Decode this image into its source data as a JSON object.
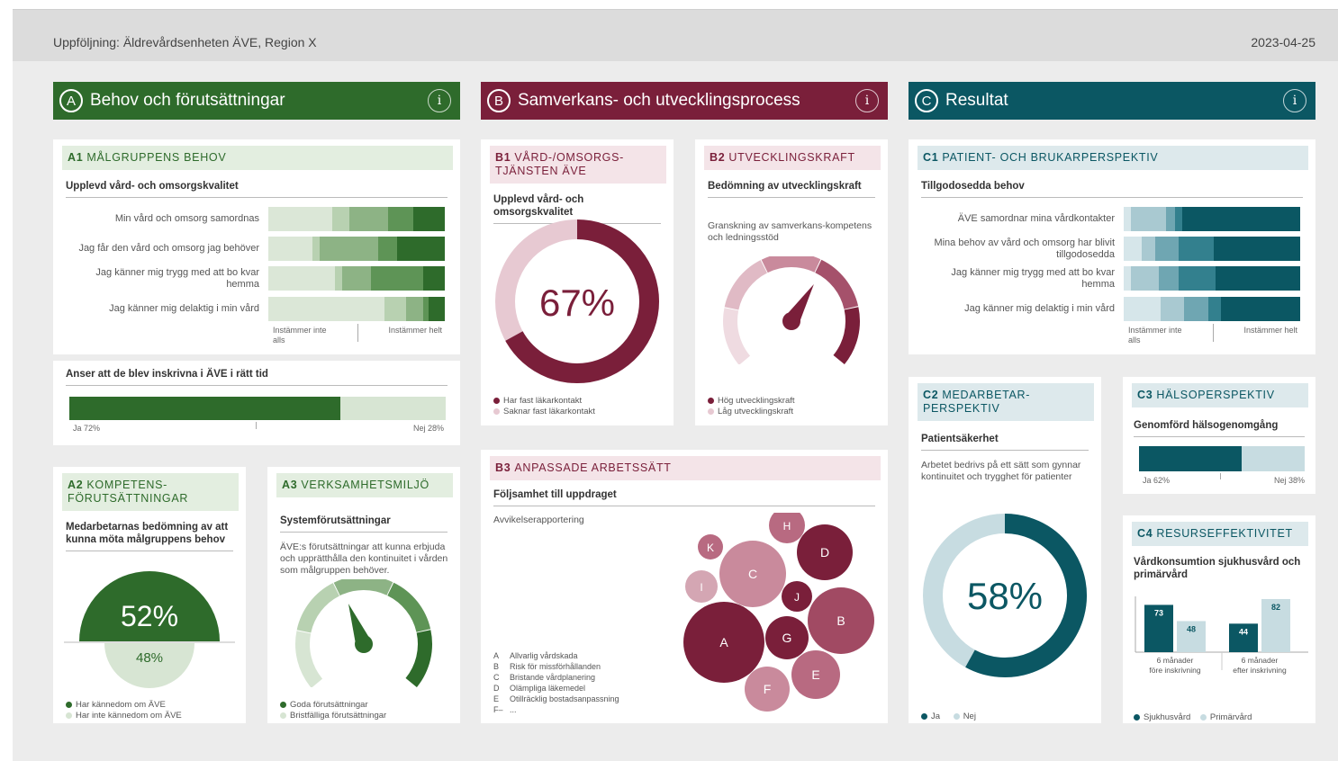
{
  "header": {
    "title": "Uppföljning: Äldrevårdsenheten ÄVE, Region X",
    "date": "2023-04-25"
  },
  "colors": {
    "green": "#2e6b2b",
    "maroon": "#7a1f3a",
    "teal": "#0b5763"
  },
  "sections": {
    "a": {
      "letter": "A",
      "title": "Behov och förutsättningar"
    },
    "b": {
      "letter": "B",
      "title": "Samverkans- och utvecklingsprocess"
    },
    "c": {
      "letter": "C",
      "title": "Resultat"
    }
  },
  "info_icon": "i",
  "a1": {
    "code": "A1",
    "title": "MÅLGRUPPENS BEHOV",
    "subtitle": "Upplevd vård- och omsorgskvalitet",
    "rows": [
      {
        "label": "Min vård och omsorg samordnas",
        "segments": [
          0.36,
          0.1,
          0.22,
          0.14,
          0.18
        ]
      },
      {
        "label": "Jag får den vård och omsorg jag behöver",
        "segments": [
          0.25,
          0.04,
          0.33,
          0.11,
          0.27
        ]
      },
      {
        "label": "Jag känner mig trygg med att bo kvar hemma",
        "segments": [
          0.38,
          0.04,
          0.16,
          0.3,
          0.12
        ]
      },
      {
        "label": "Jag känner mig delaktig i min vård",
        "segments": [
          0.66,
          0.12,
          0.1,
          0.03,
          0.09
        ]
      }
    ],
    "axis_left": "Instämmer inte alls",
    "axis_right": "Instämmer helt",
    "bar_title": "Anser att de blev inskrivna i ÄVE i rätt tid",
    "yes_pct": 72,
    "yes_label": "Ja 72%",
    "no_label": "Nej 28%"
  },
  "a2": {
    "code": "A2",
    "title": "KOMPETENS-FÖRUTSÄTTNINGAR",
    "subtitle": "Medarbetarnas bedömning av att kunna möta målgruppens behov",
    "value_top": "52%",
    "value_bottom": "48%",
    "legend": [
      "Har kännedom om ÄVE",
      "Har inte kännedom om ÄVE"
    ]
  },
  "a3": {
    "code": "A3",
    "title": "VERKSAMHETSMILJÖ",
    "subtitle": "Systemförutsättningar",
    "description": "ÄVE:s förutsättningar att kunna erbjuda och upprätthålla den kontinuitet i vården som målgruppen behöver.",
    "gauge_value": 0.42,
    "legend": [
      "Goda förutsättningar",
      "Bristfälliga förutsättningar"
    ]
  },
  "b1": {
    "code": "B1",
    "title": "VÅRD-/OMSORGS-TJÄNSTEN ÄVE",
    "subtitle": "Upplevd vård- och omsorgskvalitet",
    "value": 67,
    "label": "67%",
    "legend": [
      "Har fast läkarkontakt",
      "Saknar fast läkarkontakt"
    ]
  },
  "b2": {
    "code": "B2",
    "title": "UTVECKLINGSKRAFT",
    "subtitle": "Bedömning av utvecklingskraft",
    "description": "Granskning av samverkans-kompetens och ledningsstöd",
    "gauge_value": 0.62,
    "legend": [
      "Hög utvecklingskraft",
      "Låg utvecklingskraft"
    ]
  },
  "b3": {
    "code": "B3",
    "title": "ANPASSADE ARBETSSÄTT",
    "subtitle": "Följsamhet till uppdraget",
    "description": "Avvikelserapportering",
    "categories": [
      {
        "key": "A",
        "label": "Allvarlig vårdskada"
      },
      {
        "key": "B",
        "label": "Risk för missförhållanden"
      },
      {
        "key": "C",
        "label": "Bristande vårdplanering"
      },
      {
        "key": "D",
        "label": "Olämpliga läkemedel"
      },
      {
        "key": "E",
        "label": "Otillräcklig bostadsanpassning"
      },
      {
        "key": "F",
        "label": "..."
      }
    ],
    "bubbles": [
      "A",
      "B",
      "C",
      "D",
      "E",
      "F",
      "G",
      "H",
      "I",
      "J",
      "K"
    ]
  },
  "c1": {
    "code": "C1",
    "title": "PATIENT- OCH BRUKARPERSPEKTIV",
    "subtitle": "Tillgodosedda behov",
    "rows": [
      {
        "label": "ÄVE samordnar mina vårdkontakter",
        "segments": [
          0.04,
          0.2,
          0.05,
          0.04,
          0.67
        ]
      },
      {
        "label": "Mina behov av vård och omsorg har blivit tillgodosedda",
        "segments": [
          0.1,
          0.08,
          0.13,
          0.2,
          0.49
        ]
      },
      {
        "label": "Jag känner mig trygg med att bo kvar hemma",
        "segments": [
          0.04,
          0.16,
          0.11,
          0.21,
          0.48
        ]
      },
      {
        "label": "Jag känner mig delaktig i min vård",
        "segments": [
          0.21,
          0.13,
          0.14,
          0.07,
          0.45
        ]
      }
    ],
    "axis_left": "Instämmer inte alls",
    "axis_right": "Instämmer helt"
  },
  "c2": {
    "code": "C2",
    "title": "MEDARBETAR-PERSPEKTIV",
    "subtitle": "Patientsäkerhet",
    "description": "Arbetet bedrivs på ett sätt som gynnar kontinuitet och trygghet för patienter",
    "value": 58,
    "label": "58%",
    "legend": [
      "Ja",
      "Nej"
    ]
  },
  "c3": {
    "code": "C3",
    "title": "HÄLSOPERSPEKTIV",
    "subtitle": "Genomförd hälsogenomgång",
    "yes_pct": 62,
    "yes_label": "Ja 62%",
    "no_label": "Nej 38%"
  },
  "c4": {
    "code": "C4",
    "title": "RESURSEFFEKTIVITET",
    "subtitle": "Vårdkonsumtion sjukhusvård och primärvård",
    "legend": [
      "Sjukhusvård",
      "Primärvård"
    ]
  },
  "chart_data": [
    {
      "type": "bar",
      "id": "c4",
      "categories": [
        "6 månader före inskrivning",
        "6 månader efter inskrivning"
      ],
      "series": [
        {
          "name": "Sjukhusvård",
          "values": [
            73,
            44
          ]
        },
        {
          "name": "Primärvård",
          "values": [
            48,
            82
          ]
        }
      ],
      "ylim": [
        0,
        100
      ]
    },
    {
      "type": "pie",
      "id": "b1",
      "values": [
        67,
        33
      ],
      "labels": [
        "Har fast läkarkontakt",
        "Saknar fast läkarkontakt"
      ]
    },
    {
      "type": "pie",
      "id": "c2",
      "values": [
        58,
        42
      ],
      "labels": [
        "Ja",
        "Nej"
      ]
    },
    {
      "type": "bar",
      "id": "a1-time",
      "categories": [
        "Ja",
        "Nej"
      ],
      "values": [
        72,
        28
      ]
    },
    {
      "type": "bar",
      "id": "c3",
      "categories": [
        "Ja",
        "Nej"
      ],
      "values": [
        62,
        38
      ]
    }
  ]
}
